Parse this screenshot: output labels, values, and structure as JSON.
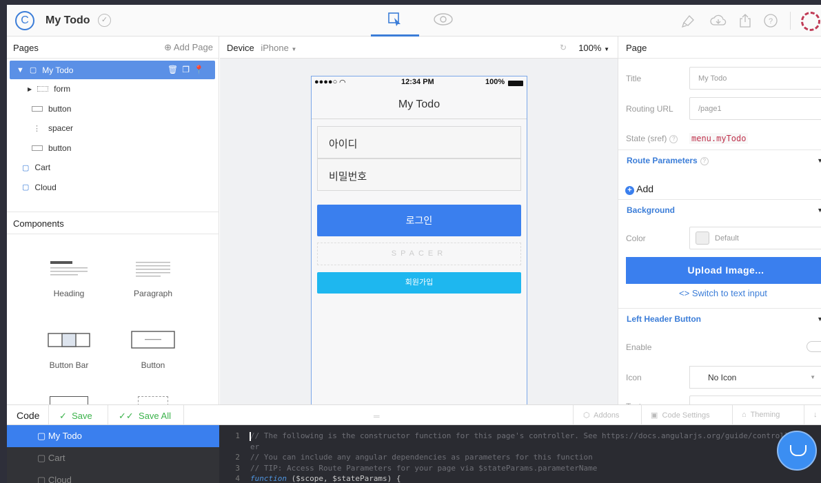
{
  "topbar": {
    "title": "My Todo",
    "logo_glyph": "C",
    "check_glyph": "✓",
    "icons": [
      "design-mode-icon",
      "preview-eye-icon",
      "clear-icon",
      "download-cloud-icon",
      "share-icon",
      "help-icon",
      "avatar"
    ]
  },
  "pages_panel": {
    "header": "Pages",
    "add_page": "Add Page",
    "tree": [
      {
        "label": "My Todo",
        "selected": true
      },
      {
        "label": "form"
      },
      {
        "label": "button"
      },
      {
        "label": "spacer"
      },
      {
        "label": "button"
      },
      {
        "label": "Cart"
      },
      {
        "label": "Cloud"
      }
    ]
  },
  "components_panel": {
    "header": "Components",
    "items": [
      "Heading",
      "Paragraph",
      "Button Bar",
      "Button"
    ]
  },
  "device_bar": {
    "label": "Device",
    "device": "iPhone",
    "zoom": "100%"
  },
  "phone": {
    "carrier": "●●●●○",
    "time": "12:34 PM",
    "battery": "100%",
    "nav_title": "My Todo",
    "id_field": "아이디",
    "password_field": "비밀번호",
    "login_button": "로그인",
    "spacer_label": "SPACER",
    "signup_button": "회원가입"
  },
  "properties": {
    "header": "Page",
    "title_label": "Title",
    "title_value": "My Todo",
    "routing_label": "Routing URL",
    "routing_value": "/page1",
    "state_label": "State (sref)",
    "state_value": "menu.myTodo",
    "route_params": "Route Parameters",
    "add": "Add",
    "background": "Background",
    "color_label": "Color",
    "color_value": "Default",
    "upload": "Upload Image...",
    "switch_text": "Switch to text input",
    "left_header": "Left Header Button",
    "enable_label": "Enable",
    "icon_label": "Icon",
    "icon_value": "No Icon",
    "text_label": "Text"
  },
  "code_bar": {
    "label": "Code",
    "save": "Save",
    "save_all": "Save All",
    "addons": "Addons",
    "code_settings": "Code Settings",
    "theming": "Theming"
  },
  "code_files": [
    "My Todo",
    "Cart",
    "Cloud"
  ],
  "code_lines": [
    {
      "n": "1",
      "text": "// The following is the constructor function for this page's controller. See https://docs.angularjs.org/guide/controll"
    },
    {
      "n": "",
      "text": "er"
    },
    {
      "n": "2",
      "text": "// You can include any angular dependencies as parameters for this function"
    },
    {
      "n": "3",
      "text": "// TIP: Access Route Parameters for your page via $stateParams.parameterName"
    },
    {
      "n": "4",
      "kw": "function",
      "text": " ($scope, $stateParams) {"
    }
  ],
  "colors": {
    "accent": "#3a7fee",
    "signup": "#1eb7ef",
    "sref": "#c0344e",
    "save_green": "#3ab24a"
  }
}
